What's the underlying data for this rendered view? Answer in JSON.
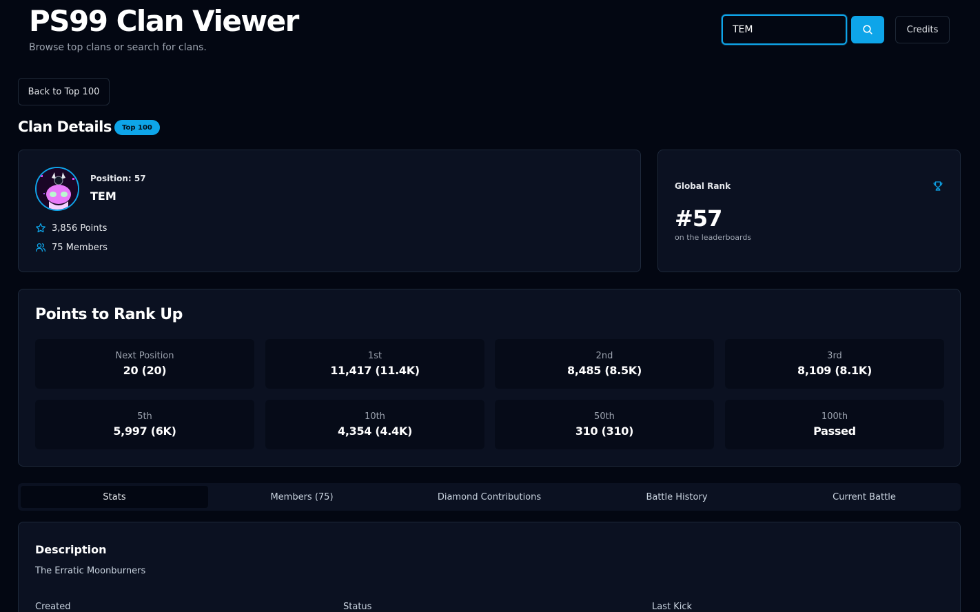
{
  "header": {
    "title": "PS99 Clan Viewer",
    "subtitle": "Browse top clans or search for clans.",
    "search_value": "TEM",
    "credits_label": "Credits"
  },
  "nav": {
    "back_label": "Back to Top 100"
  },
  "clan_details": {
    "heading": "Clan Details",
    "badge": "Top 100",
    "position": "Position: 57",
    "name": "TEM",
    "points": "3,856 Points",
    "members": "75 Members"
  },
  "global_rank": {
    "label": "Global Rank",
    "value": "#57",
    "sub": "on the leaderboards"
  },
  "rank_up": {
    "title": "Points to Rank Up",
    "tiles": [
      {
        "label": "Next Position",
        "value": "20 (20)"
      },
      {
        "label": "1st",
        "value": "11,417 (11.4K)"
      },
      {
        "label": "2nd",
        "value": "8,485 (8.5K)"
      },
      {
        "label": "3rd",
        "value": "8,109 (8.1K)"
      },
      {
        "label": "5th",
        "value": "5,997 (6K)"
      },
      {
        "label": "10th",
        "value": "4,354 (4.4K)"
      },
      {
        "label": "50th",
        "value": "310 (310)"
      },
      {
        "label": "100th",
        "value": "Passed"
      }
    ]
  },
  "tabs": [
    {
      "label": "Stats",
      "active": true
    },
    {
      "label": "Members (75)",
      "active": false
    },
    {
      "label": "Diamond Contributions",
      "active": false
    },
    {
      "label": "Battle History",
      "active": false
    },
    {
      "label": "Current Battle",
      "active": false
    }
  ],
  "stats": {
    "description_title": "Description",
    "description": "The Erratic Moonburners",
    "created_label": "Created",
    "status_label": "Status",
    "last_kick_label": "Last Kick"
  },
  "colors": {
    "accent": "#0ea5e9",
    "background": "#030712",
    "card": "#0b1121"
  }
}
